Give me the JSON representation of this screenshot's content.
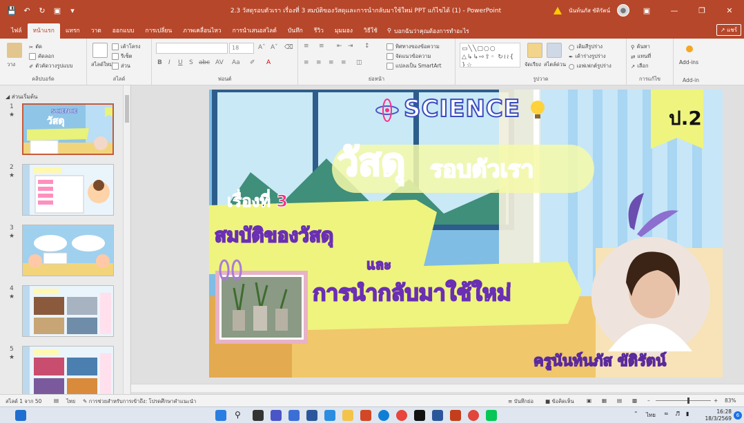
{
  "titlebar": {
    "title": "2.3 วัสดุรอบตัวเรา เรื่องที่ 3 สมบัติของวัสดุและการนำกลับมาใช้ใหม่ PPT แก้ไขได้ (1) - PowerPoint",
    "user": "นันท์นภัส ขัติรัตน์"
  },
  "tabs": [
    "ไฟล์",
    "หน้าแรก",
    "แทรก",
    "วาด",
    "ออกแบบ",
    "การเปลี่ยน",
    "ภาพเคลื่อนไหว",
    "การนำเสนอสไลด์",
    "บันทึก",
    "รีวิว",
    "มุมมอง",
    "วิธีใช้"
  ],
  "active_tab": "หน้าแรก",
  "tell_me": "บอกฉันว่าคุณต้องการทำอะไร",
  "share": "แชร์",
  "ribbon": {
    "clipboard": {
      "paste": "วาง",
      "cut": "ตัด",
      "copy": "คัดลอก",
      "format_painter": "ตัวคัดวางรูปแบบ",
      "label": "คลิปบอร์ด"
    },
    "slides": {
      "new_slide": "สไลด์ใหม่",
      "layout": "เค้าโครง",
      "reset": "รีเซ็ต",
      "section": "ส่วน",
      "label": "สไลด์"
    },
    "font": {
      "size": "18",
      "label": "ฟอนต์"
    },
    "paragraph": {
      "text_direction": "ทิศทางของข้อความ",
      "align_text": "จัดแนวข้อความ",
      "smartart": "แปลงเป็น SmartArt",
      "label": "ย่อหน้า"
    },
    "drawing": {
      "arrange": "จัดเรียง",
      "quick_styles": "สไตล์ด่วน",
      "shape_fill": "เติมสีรูปร่าง",
      "shape_outline": "เค้าร่างรูปร่าง",
      "shape_effects": "เอฟเฟกต์รูปร่าง",
      "label": "รูปวาด"
    },
    "editing": {
      "find": "ค้นหา",
      "replace": "แทนที่",
      "select": "เลือก",
      "label": "การแก้ไข"
    },
    "addins": {
      "button": "Add-ins",
      "label": "Add-in"
    }
  },
  "thumbpane": {
    "title": "ส่วนเริ่มต้น",
    "numbers": [
      "1",
      "2",
      "3",
      "4",
      "5"
    ]
  },
  "slide": {
    "science": "SCIENCE",
    "grade": "ป.2",
    "title_big": "วัสดุ",
    "title_rest": "รอบตัวเรา",
    "story_prefix": "เรื่องที่",
    "story_num": "3",
    "subtitle1": "สมบัติของวัสดุ",
    "and": "และ",
    "subtitle2": "การนำกลับมาใช้ใหม่",
    "teacher": "ครูนันท์นภัส ขัติรัตน์"
  },
  "statusbar": {
    "slide_count": "สไลด์ 1 จาก 50",
    "language": "ไทย",
    "accessibility": "การช่วยสำหรับการเข้าถึง: โปรดศึกษาคำแนะนำ",
    "notes": "บันทึกย่อ",
    "comments": "ข้อคิดเห็น",
    "zoom": "83%"
  },
  "taskbar": {
    "lang": "ไทย",
    "time": "16:28",
    "date": "18/3/2569",
    "notifications": "6"
  },
  "colors": {
    "accent": "#b7472a",
    "pink": "#ff2d86",
    "lime": "#e9f27a"
  }
}
